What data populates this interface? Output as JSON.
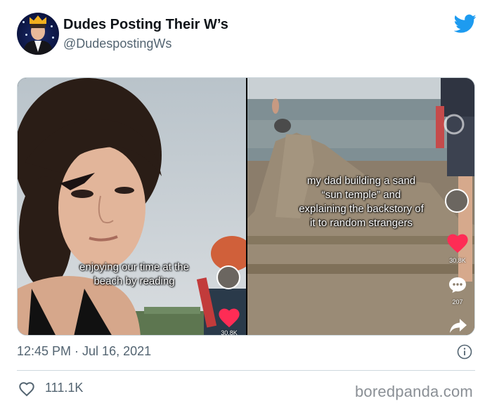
{
  "author": {
    "display_name": "Dudes Posting Their W’s",
    "handle": "@DudespostingWs",
    "avatar_icon": "crowned-man-avatar"
  },
  "brand_icon": "twitter-bird-icon",
  "brand_color": "#1d9bf0",
  "media": {
    "left": {
      "caption_lines": [
        "enjoying our time at the",
        "beach by reading"
      ],
      "like_count": "30.8K"
    },
    "right": {
      "caption_lines": [
        "my dad building a sand",
        "“sun temple” and",
        "explaining the backstory of",
        "it to random strangers"
      ],
      "like_count": "30.8K",
      "comment_count": "207"
    }
  },
  "timestamp": "12:45 PM · Jul 16, 2021",
  "likes": "111.1K",
  "watermark": "boredpanda.com"
}
